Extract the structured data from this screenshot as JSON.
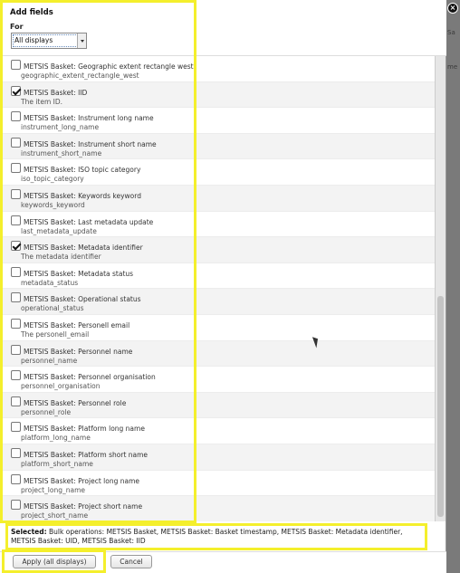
{
  "dialog": {
    "title": "Add fields",
    "for_label": "For",
    "for_select_value": "All displays",
    "close_icon": "close-icon"
  },
  "fields": [
    {
      "label": "METSIS Basket: Geographic extent rectangle west",
      "description": "geographic_extent_rectangle_west",
      "checked": false
    },
    {
      "label": "METSIS Basket: IID",
      "description": "The item ID.",
      "checked": true
    },
    {
      "label": "METSIS Basket: Instrument long name",
      "description": "instrument_long_name",
      "checked": false
    },
    {
      "label": "METSIS Basket: Instrument short name",
      "description": "instrument_short_name",
      "checked": false
    },
    {
      "label": "METSIS Basket: ISO topic category",
      "description": "iso_topic_category",
      "checked": false
    },
    {
      "label": "METSIS Basket: Keywords keyword",
      "description": "keywords_keyword",
      "checked": false
    },
    {
      "label": "METSIS Basket: Last metadata update",
      "description": "last_metadata_update",
      "checked": false
    },
    {
      "label": "METSIS Basket: Metadata identifier",
      "description": "The metadata identifier",
      "checked": true
    },
    {
      "label": "METSIS Basket: Metadata status",
      "description": "metadata_status",
      "checked": false
    },
    {
      "label": "METSIS Basket: Operational status",
      "description": "operational_status",
      "checked": false
    },
    {
      "label": "METSIS Basket: Personell email",
      "description": "The personell_email",
      "checked": false
    },
    {
      "label": "METSIS Basket: Personnel name",
      "description": "personnel_name",
      "checked": false
    },
    {
      "label": "METSIS Basket: Personnel organisation",
      "description": "personnel_organisation",
      "checked": false
    },
    {
      "label": "METSIS Basket: Personnel role",
      "description": "personnel_role",
      "checked": false
    },
    {
      "label": "METSIS Basket: Platform long name",
      "description": "platform_long_name",
      "checked": false
    },
    {
      "label": "METSIS Basket: Platform short name",
      "description": "platform_short_name",
      "checked": false
    },
    {
      "label": "METSIS Basket: Project long name",
      "description": "project_long_name",
      "checked": false
    },
    {
      "label": "METSIS Basket: Project short name",
      "description": "project_short_name",
      "checked": false
    }
  ],
  "selected": {
    "label": "Selected:",
    "text": "Bulk operations: METSIS Basket, METSIS Basket: Basket timestamp, METSIS Basket: Metadata identifier, METSIS Basket: UID, METSIS Basket: IID"
  },
  "buttons": {
    "apply": "Apply (all displays)",
    "cancel": "Cancel"
  },
  "background_fragments": [
    "Sa",
    "me"
  ],
  "colors": {
    "highlight": "#f4ef2c"
  }
}
